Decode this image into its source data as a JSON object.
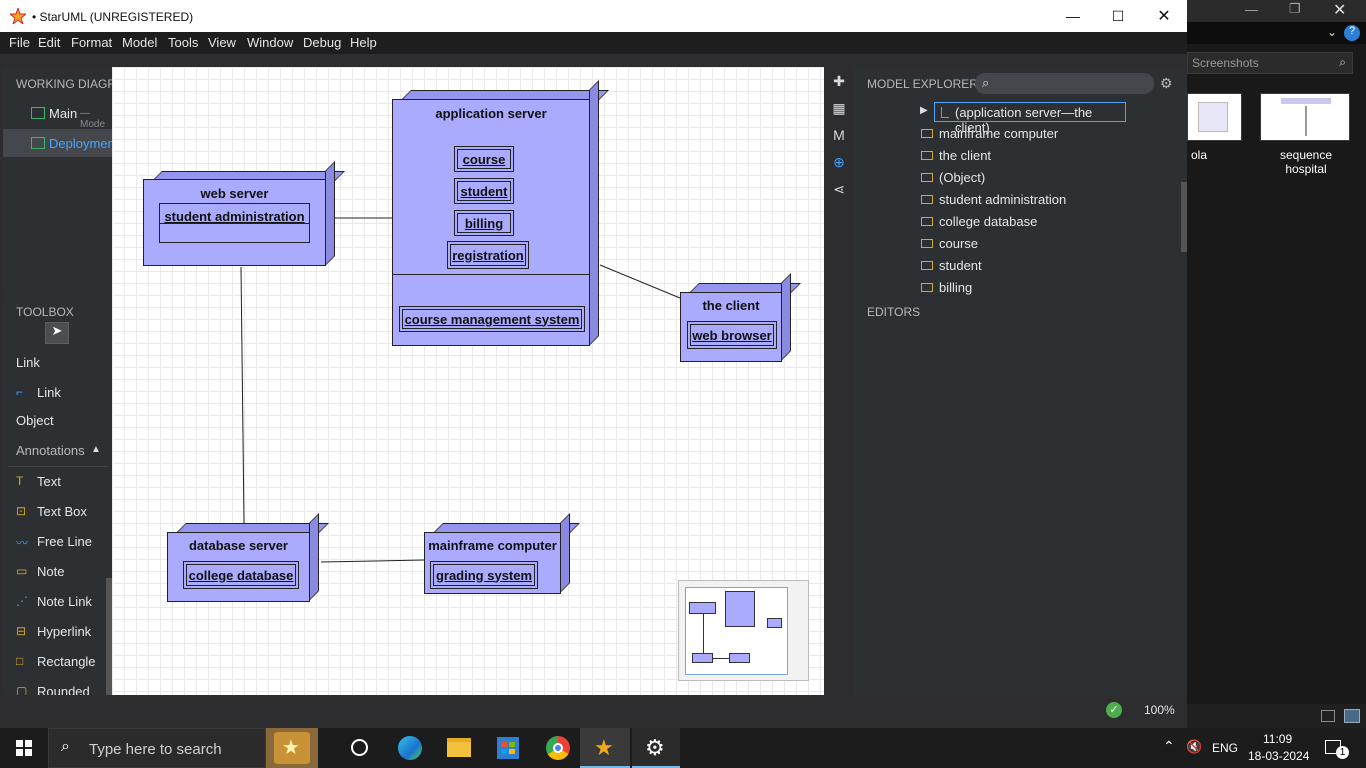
{
  "window": {
    "title": "• StarUML (UNREGISTERED)",
    "menu": [
      "File",
      "Edit",
      "Format",
      "Model",
      "Tools",
      "View",
      "Window",
      "Debug",
      "Help"
    ]
  },
  "working_diagrams": {
    "header": "WORKING DIAGRA",
    "items": [
      {
        "label": "Main",
        "sub": "— Mode"
      },
      {
        "label": "Deploymen",
        "sub": ""
      }
    ]
  },
  "toolbox": {
    "header": "TOOLBOX",
    "items": [
      {
        "label": "Link",
        "kind": "heading"
      },
      {
        "label": "Link",
        "kind": "tool",
        "icon": "link-icon"
      },
      {
        "label": "Object",
        "kind": "heading"
      },
      {
        "label": "Annotations",
        "kind": "section"
      },
      {
        "label": "Text",
        "kind": "tool",
        "icon": "text-icon"
      },
      {
        "label": "Text Box",
        "kind": "tool",
        "icon": "textbox-icon"
      },
      {
        "label": "Free Line",
        "kind": "tool",
        "icon": "freeline-icon"
      },
      {
        "label": "Note",
        "kind": "tool",
        "icon": "note-icon"
      },
      {
        "label": "Note Link",
        "kind": "tool",
        "icon": "notelink-icon"
      },
      {
        "label": "Hyperlink",
        "kind": "tool",
        "icon": "hyperlink-icon"
      },
      {
        "label": "Rectangle",
        "kind": "tool",
        "icon": "rectangle-icon"
      },
      {
        "label": "Rounded",
        "kind": "tool",
        "icon": "rounded-icon"
      }
    ]
  },
  "diagram": {
    "nodes": {
      "web_server": {
        "title": "web server",
        "artifacts": [
          "student administration"
        ]
      },
      "application_server": {
        "title": "application server",
        "artifacts": [
          "course",
          "student",
          "billing",
          "registration",
          "course management system"
        ]
      },
      "the_client": {
        "title": "the client",
        "artifacts": [
          "web browser"
        ]
      },
      "database_server": {
        "title": "database server",
        "artifacts": [
          "college database"
        ]
      },
      "mainframe_computer": {
        "title": "mainframe computer",
        "artifacts": [
          "grading system"
        ]
      }
    }
  },
  "model_explorer": {
    "header": "MODEL EXPLORER",
    "selected": "(application server—the client)",
    "items": [
      "mainframe computer",
      "the client",
      "(Object)",
      "student administration",
      "college database",
      "course",
      "student",
      "billing"
    ]
  },
  "editors": {
    "header": "EDITORS"
  },
  "status": {
    "zoom": "100%"
  },
  "background": {
    "search_placeholder": "Screenshots",
    "thumbs": [
      "ola",
      "sequence hospital"
    ]
  },
  "taskbar": {
    "search_placeholder": "Type here to search",
    "lang": "ENG",
    "time": "11:09",
    "date": "18-03-2024",
    "notif_count": "1"
  },
  "colors": {
    "node_fill": "#aaaaff",
    "accent": "#2196f3"
  }
}
